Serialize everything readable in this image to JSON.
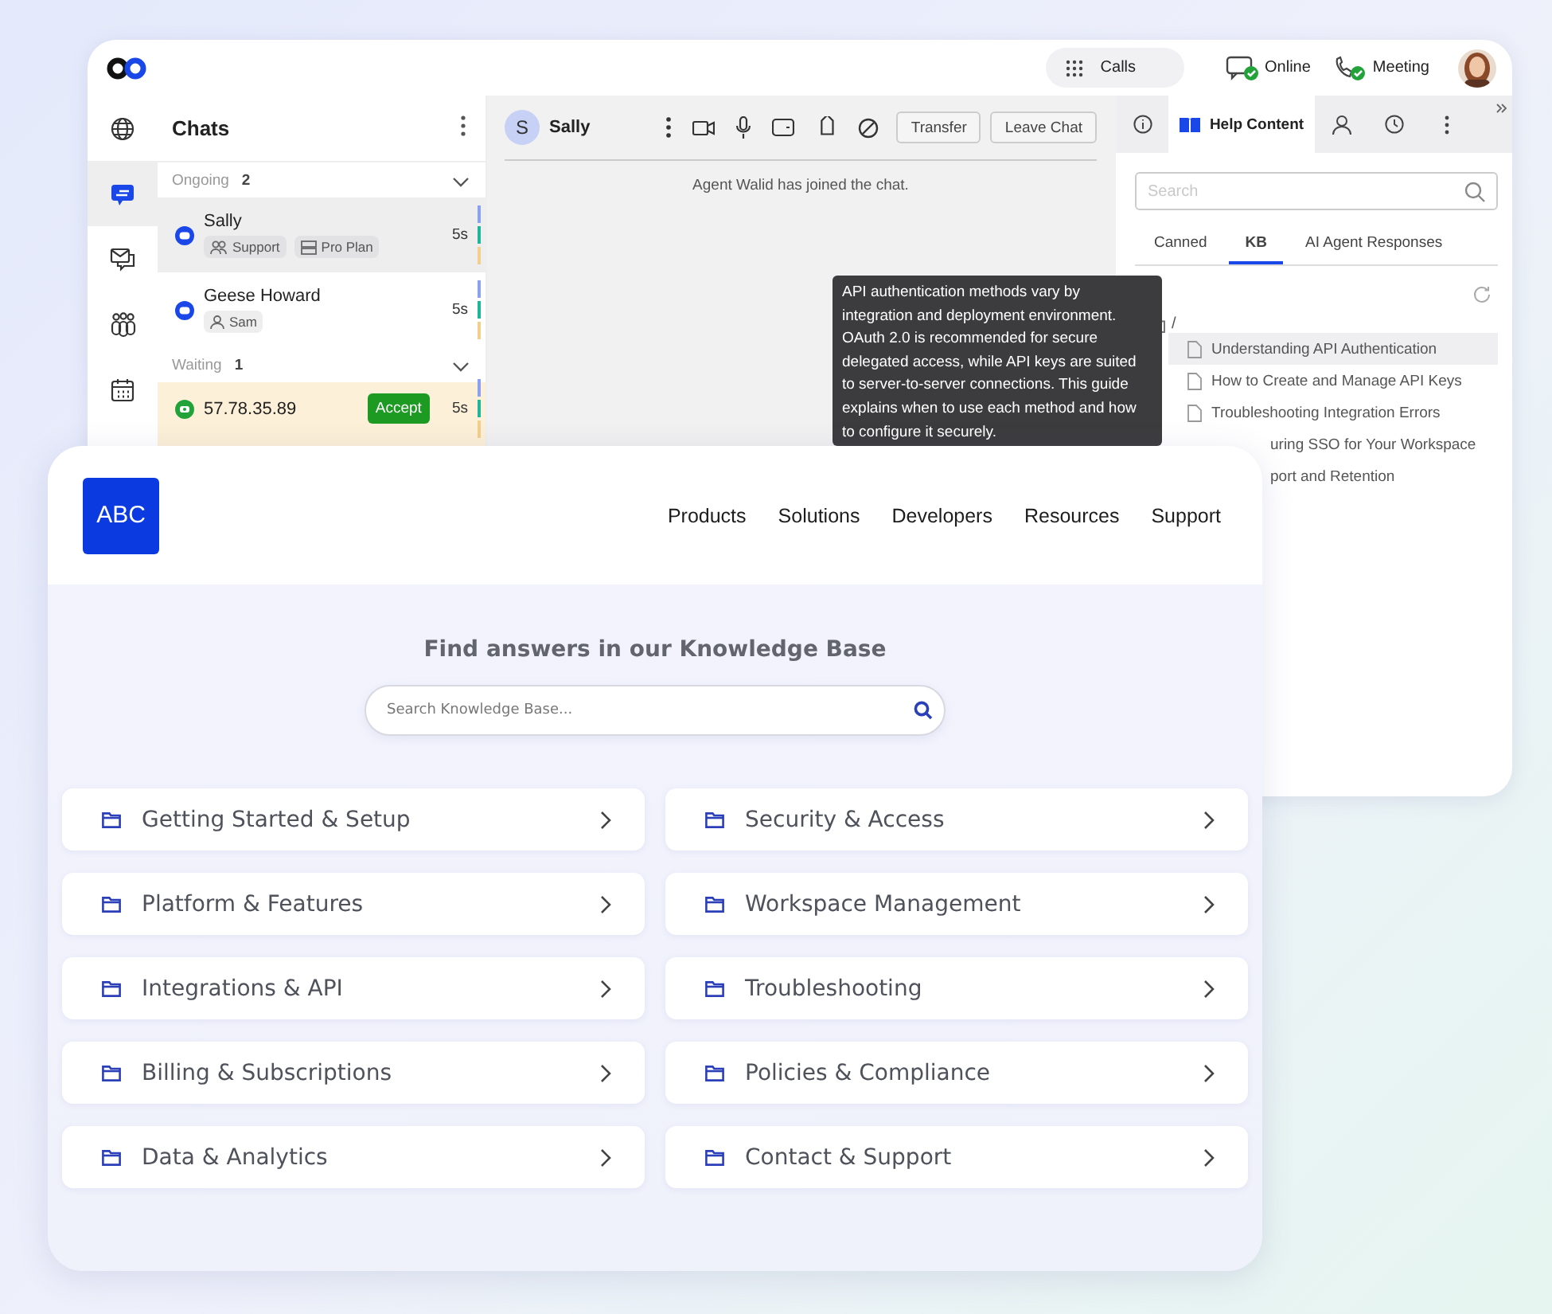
{
  "app_window": {
    "top_bar": {
      "calls_button": "Calls",
      "statuses": [
        {
          "kind": "chat",
          "label": "Online"
        },
        {
          "kind": "phone",
          "label": "Meeting"
        }
      ]
    },
    "rail": [
      {
        "kind": "globe",
        "selected": false
      },
      {
        "kind": "chat",
        "selected": true
      },
      {
        "kind": "mail",
        "selected": false
      },
      {
        "kind": "team",
        "selected": false
      },
      {
        "kind": "calendar",
        "selected": false
      }
    ],
    "chats": {
      "title": "Chats",
      "groups": [
        {
          "label": "Ongoing",
          "count": "2",
          "expanded": true,
          "items": [
            {
              "kind": "ongoing",
              "name": "Sally",
              "selected": true,
              "tags": [
                {
                  "kind": "group",
                  "label": "Support"
                },
                {
                  "kind": "plan",
                  "label": "Pro Plan"
                }
              ],
              "time": "5s"
            },
            {
              "kind": "ongoing",
              "name": "Geese Howard",
              "selected": false,
              "tags": [
                {
                  "kind": "person",
                  "label": "Sam"
                }
              ],
              "time": "5s"
            }
          ]
        },
        {
          "label": "Waiting",
          "count": "1",
          "expanded": true,
          "items": [
            {
              "kind": "waiting",
              "name": "57.78.35.89",
              "selected": false,
              "action": "Accept",
              "time": "5s"
            }
          ]
        }
      ]
    },
    "conversation": {
      "avatar": "S",
      "name": "Sally",
      "actions": [
        "Transfer",
        "Leave Chat"
      ],
      "messages": [
        "Agent Walid has joined the chat."
      ]
    },
    "help_panel": {
      "tabs": [
        {
          "kind": "info",
          "selected": false
        },
        {
          "kind": "help",
          "label": "Help Content",
          "selected": true
        },
        {
          "kind": "person",
          "selected": false
        },
        {
          "kind": "history",
          "selected": false
        },
        {
          "kind": "more",
          "selected": false
        }
      ],
      "search": {
        "placeholder": "Search"
      },
      "subtabs": [
        {
          "label": "Canned",
          "selected": false
        },
        {
          "label": "KB",
          "selected": true
        },
        {
          "label": "AI Agent  Responses",
          "selected": false
        }
      ],
      "path": "/",
      "articles": [
        {
          "kind": "full",
          "title": "Understanding API Authentication",
          "selected": true
        },
        {
          "kind": "full",
          "title": "How to Create and Manage API Keys",
          "selected": false
        },
        {
          "kind": "full",
          "title": "Troubleshooting Integration Errors",
          "selected": false
        },
        {
          "kind": "partial",
          "title": "uring SSO for Your Workspace",
          "selected": false
        },
        {
          "kind": "partial",
          "title": "port and Retention",
          "selected": false
        }
      ]
    },
    "tooltip": "API authentication methods vary by integration and deployment environment. OAuth 2.0 is recommended for secure delegated access, while API keys are suited to server-to-server connections. This guide explains when to use each method and how to configure it securely."
  },
  "kb_site": {
    "logo": "ABC",
    "nav": [
      "Products",
      "Solutions",
      "Developers",
      "Resources",
      "Support"
    ],
    "heading": "Find answers in our Knowledge Base",
    "search": {
      "placeholder": "Search Knowledge Base..."
    },
    "categories": [
      "Getting Started & Setup",
      "Security & Access",
      "Platform & Features",
      "Workspace Management",
      "Integrations & API",
      "Troubleshooting",
      "Billing & Subscriptions",
      "Policies & Compliance",
      "Data & Analytics",
      "Contact & Support"
    ]
  }
}
